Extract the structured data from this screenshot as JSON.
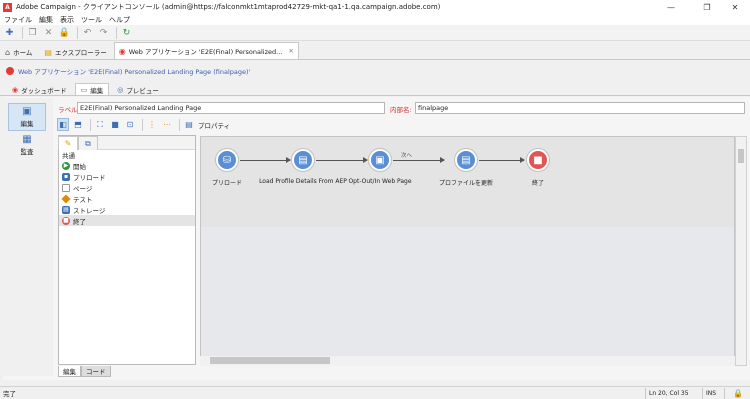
{
  "window": {
    "title": "Adobe Campaign - クライアントコンソール (admin@https://falconmkt1mtaprod42729-mkt-qa1-1.qa.campaign.adobe.com)",
    "logo": "A"
  },
  "menu": [
    "ファイル",
    "編集",
    "表示",
    "ツール",
    "ヘルプ"
  ],
  "tabs": [
    {
      "label": "ホーム",
      "icon": "home-icon"
    },
    {
      "label": "エクスプローラー",
      "icon": "folder-icon"
    },
    {
      "label": "Web アプリケーション 'E2E(Final) Personalized...",
      "icon": "web-app-icon"
    }
  ],
  "path": "Web アプリケーション 'E2E(Final) Personalized Landing Page (finalpage)'",
  "subtabs": [
    "ダッシュボード",
    "編集",
    "プレビュー"
  ],
  "leftnav": [
    {
      "label": "編集"
    },
    {
      "label": "監査"
    }
  ],
  "form": {
    "label_caption": "ラベル:",
    "label_value": "E2E(Final) Personalized Landing Page",
    "internal_caption": "内部名:",
    "internal_value": "finalpage"
  },
  "editor_toolbar": {
    "properties": "プロパティ"
  },
  "palette": {
    "group": "共通",
    "items": [
      "開始",
      "プリロード",
      "ページ",
      "テスト",
      "ストレージ",
      "終了"
    ]
  },
  "workflow": {
    "nodes": [
      "プリロード",
      "Load Profile Details From AEP",
      "Opt-Out/In Web Page",
      "プロファイルを更新",
      "終了"
    ],
    "transition_label": "次へ"
  },
  "bottom_tabs": [
    "編集",
    "コード"
  ],
  "status": {
    "left": "完了",
    "position": "Ln 20, Col 35",
    "mode": "INS"
  },
  "colors": {
    "accent": "#3d6fb5",
    "brand": "#e53935",
    "link": "#3a5fb0"
  }
}
